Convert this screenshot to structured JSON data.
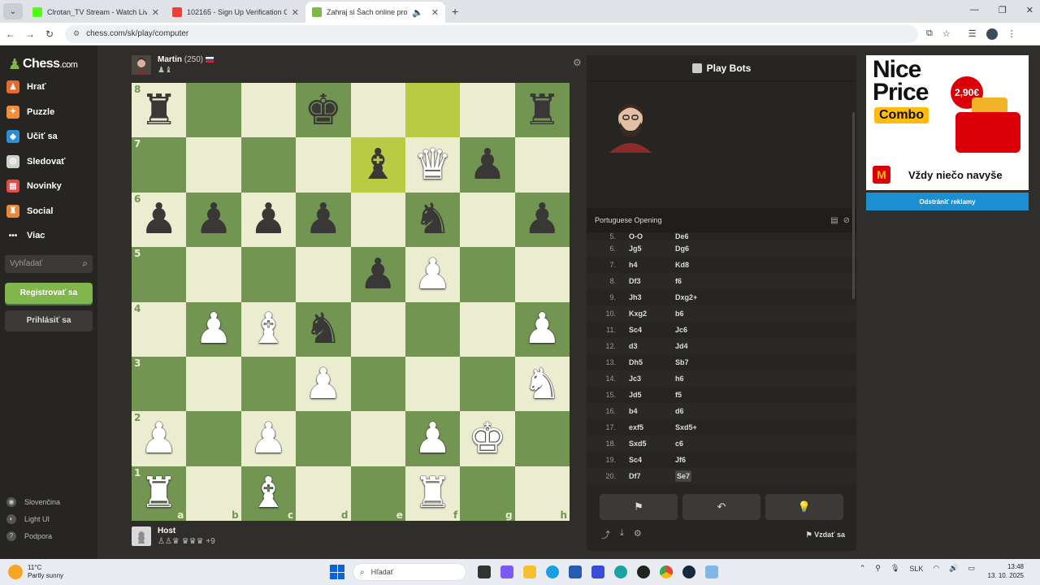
{
  "browser": {
    "tabs": [
      {
        "title": "Clrotan_TV Stream - Watch Live",
        "color": "#53fc18",
        "active": false
      },
      {
        "title": "102165 - Sign Up Verification C",
        "color": "#ea4335",
        "active": false
      },
      {
        "title": "Zahraj si Šach online proti p",
        "color": "#81b64c",
        "active": true
      }
    ],
    "url": "chess.com/sk/play/computer"
  },
  "sidebar": {
    "logo": "Chess",
    "logo_suffix": ".com",
    "items": [
      {
        "label": "Hrať",
        "icon": "play-icon",
        "color": "#e46b2b"
      },
      {
        "label": "Puzzle",
        "icon": "puzzle-icon",
        "color": "#f08c3a"
      },
      {
        "label": "Učiť sa",
        "icon": "learn-icon",
        "color": "#2a8fd6"
      },
      {
        "label": "Sledovať",
        "icon": "watch-icon",
        "color": "#d0d0d0"
      },
      {
        "label": "Novinky",
        "icon": "news-icon",
        "color": "#e04a4a"
      },
      {
        "label": "Social",
        "icon": "social-icon",
        "color": "#e58a3c"
      },
      {
        "label": "Viac",
        "icon": "more-icon",
        "color": "#262522"
      }
    ],
    "search_placeholder": "Vyhľadať",
    "register_label": "Registrovať sa",
    "login_label": "Prihlásiť sa",
    "bottom": [
      {
        "label": "Slovenčina",
        "icon": "globe-icon"
      },
      {
        "label": "Light UI",
        "icon": "theme-icon"
      },
      {
        "label": "Podpora",
        "icon": "help-icon"
      }
    ]
  },
  "top_player": {
    "name": "Martin",
    "rating": "(250)",
    "captures": "♟♝"
  },
  "bottom_player": {
    "name": "Host",
    "captures": "♙♙♛ ♛♛♛",
    "advantage": "+9"
  },
  "board": {
    "ranks": [
      "8",
      "7",
      "6",
      "5",
      "4",
      "3",
      "2",
      "1"
    ],
    "files": [
      "a",
      "b",
      "c",
      "d",
      "e",
      "f",
      "g",
      "h"
    ],
    "rows": [
      [
        "r",
        "",
        "",
        "k",
        "",
        "",
        "",
        "r"
      ],
      [
        "",
        "",
        "",
        "",
        "b",
        "Q",
        "p",
        ""
      ],
      [
        "p",
        "p",
        "p",
        "p",
        "",
        "n",
        "",
        "p"
      ],
      [
        "",
        "",
        "",
        "",
        "p",
        "P",
        "",
        ""
      ],
      [
        "",
        "P",
        "B",
        "n",
        "",
        "",
        "",
        "P"
      ],
      [
        "",
        "",
        "",
        "P",
        "",
        "",
        "",
        "N"
      ],
      [
        "P",
        "",
        "P",
        "",
        "",
        "P",
        "K",
        ""
      ],
      [
        "R",
        "",
        "B",
        "",
        "",
        "R",
        "",
        ""
      ]
    ],
    "highlight": [
      [
        0,
        5
      ],
      [
        1,
        4
      ]
    ]
  },
  "panel": {
    "title": "Play Bots",
    "opening": "Portuguese Opening",
    "moves": [
      {
        "n": "5.",
        "w": "O-O",
        "b": "De6"
      },
      {
        "n": "6.",
        "w": "Jg5",
        "b": "Dg6"
      },
      {
        "n": "7.",
        "w": "h4",
        "b": "Kd8"
      },
      {
        "n": "8.",
        "w": "Df3",
        "b": "f6"
      },
      {
        "n": "9.",
        "w": "Jh3",
        "b": "Dxg2+"
      },
      {
        "n": "10.",
        "w": "Kxg2",
        "b": "b6"
      },
      {
        "n": "11.",
        "w": "Sc4",
        "b": "Jc6"
      },
      {
        "n": "12.",
        "w": "d3",
        "b": "Jd4"
      },
      {
        "n": "13.",
        "w": "Dh5",
        "b": "Sb7"
      },
      {
        "n": "14.",
        "w": "Jc3",
        "b": "h6"
      },
      {
        "n": "15.",
        "w": "Jd5",
        "b": "f5"
      },
      {
        "n": "16.",
        "w": "b4",
        "b": "d6"
      },
      {
        "n": "17.",
        "w": "exf5",
        "b": "Sxd5+"
      },
      {
        "n": "18.",
        "w": "Sxd5",
        "b": "c6"
      },
      {
        "n": "19.",
        "w": "Sc4",
        "b": "Jf6"
      },
      {
        "n": "20.",
        "w": "Df7",
        "b": "Se7"
      }
    ],
    "resign_label": "Vzdať sa"
  },
  "ad": {
    "headline_1": "Nice",
    "headline_2": "Price",
    "combo": "Combo",
    "price": "2,90€",
    "tagline": "Vždy niečo navyše",
    "remove_label": "Odstrániť reklamy"
  },
  "taskbar": {
    "temp": "11°C",
    "weather": "Partly sunny",
    "search": "Hľadať",
    "lang": "SLK",
    "time": "13:48",
    "date": "13. 10. 2025"
  }
}
